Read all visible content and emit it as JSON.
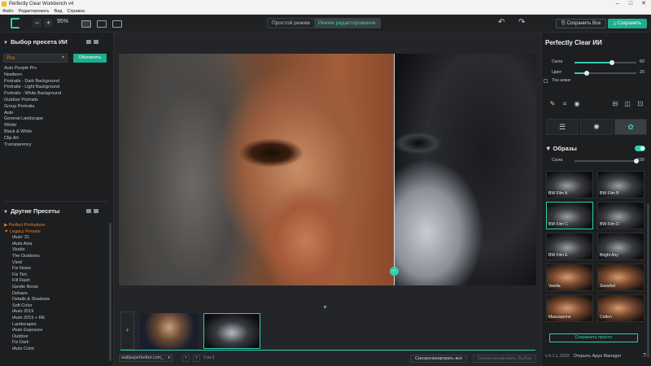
{
  "window": {
    "title": "Perfectly Clear Workbench v4"
  },
  "menu": [
    "Файл",
    "Редактировать",
    "Вид",
    "Справка"
  ],
  "toolbar": {
    "zoom": "95%",
    "mode_simple": "Простой режим",
    "mode_edit": "Режим редактирования",
    "save_all": "Сохранить Все",
    "save": "Сохранить"
  },
  "left": {
    "ai_header": "Выбор пресета ИИ",
    "selected_preset": "Pro",
    "refresh": "Обновлять",
    "ai_presets": [
      "Auto People Pro",
      "Newborn",
      "Portraits - Dark Background",
      "Portraits - Light Background",
      "Portraits - White Background",
      "Outdoor Portraits",
      "Group Portraits",
      "Auto",
      "General Landscape",
      "Winter",
      "Black & White",
      "Clip Art",
      "Transparency"
    ],
    "other_header": "Другие Пресеты",
    "cat_perfect": "Perfect Portraiture",
    "cat_legacy": "Legacy Presets",
    "legacy": [
      "iAuto '21",
      "iAuto Asia",
      "Studio",
      "The Outdoors",
      "Vivid",
      "Fix Noise",
      "Fix Tint",
      "Fill Flash",
      "Gentle Boost",
      "Dehaze",
      "Details & Shadows",
      "Soft Color",
      "iAuto 2019",
      "iAuto 2019 + RE",
      "Landscapes",
      "iAuto Exposure",
      "Outdoor",
      "Fix Dark",
      "iAuto Color"
    ]
  },
  "bottom": {
    "url": "wallpaperbetter.com_",
    "pager": "2 из 2",
    "sync_all": "Синхронизировать все",
    "sync_selected": "Синхронизировать Выбор"
  },
  "right": {
    "title": "Perfectly Clear ИИ",
    "strength_label": "Сила",
    "strength_value": "60",
    "strength": 0.6,
    "color_label": "Цвет",
    "color_value": "20",
    "color": 0.2,
    "skin_tone": "Тон кожи",
    "looks_header": "Образы",
    "looks_strength_label": "Сила",
    "looks_strength_value": "100",
    "looks_strength": 1.0,
    "looks": [
      "BW Film A",
      "BW Film B",
      "BW Film C",
      "BW Film D",
      "BW Film E",
      "Bright Airy",
      "Vanilla",
      "Snowfall",
      "Mascarpone",
      "Cotton"
    ],
    "save_preset": "Сохранить пресет",
    "version": "v.4.1.1.2503",
    "apps_manager": "Открыть Apps Manager"
  },
  "colors": {
    "accent": "#2fd1b0",
    "orange": "#e7802a",
    "bg": "#1c1e20"
  }
}
